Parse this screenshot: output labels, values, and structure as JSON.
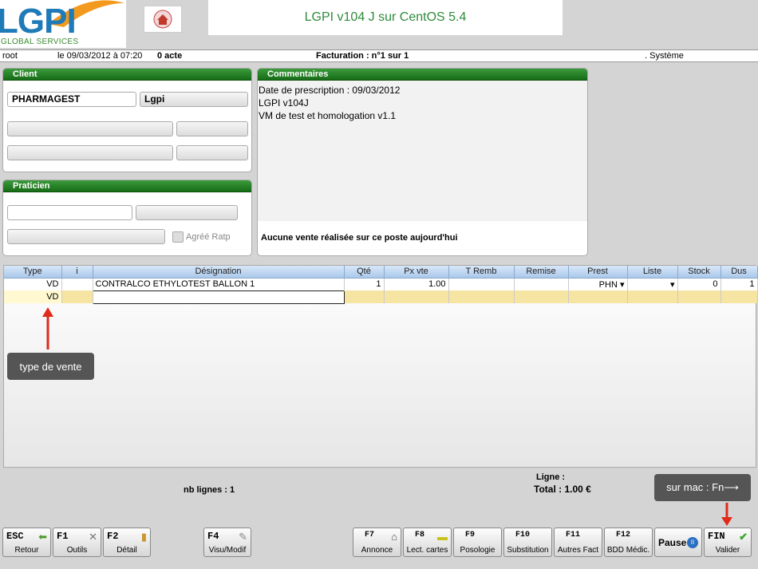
{
  "header": {
    "logo_text": "LGPI",
    "logo_sub": "GLOBAL SERVICES",
    "title": "LGPI v104 J sur CentOS 5.4"
  },
  "infobar": {
    "user": "root",
    "datetime": "le 09/03/2012 à 07:20",
    "acts": "0 acte",
    "billing": "Facturation : n°1 sur 1",
    "system": ". Système"
  },
  "client": {
    "title": "Client",
    "name": "PHARMAGEST",
    "first_name": "Lgpi"
  },
  "praticien": {
    "title": "Praticien",
    "agree_label": "Agréé Ratp"
  },
  "comments": {
    "title": "Commentaires",
    "lines": [
      "Date de prescription : 09/03/2012",
      "LGPI v104J",
      "VM de test et homologation v1.1"
    ],
    "no_sale": "Aucune vente réalisée sur ce poste aujourd'hui"
  },
  "grid": {
    "columns": [
      "Type",
      "i",
      "Désignation",
      "Qté",
      "Px vte",
      "T Remb",
      "Remise",
      "Prest",
      "Liste",
      "Stock",
      "Dus"
    ],
    "row1": {
      "type": "VD",
      "designation": "CONTRALCO ETHYLOTEST BALLON  1",
      "qte": "1",
      "px_vte": "1.00",
      "prest": "PHN",
      "stock": "0",
      "dus": "1"
    },
    "row2": {
      "type": "VD"
    }
  },
  "tips": {
    "type_vente": "type de vente",
    "mac": "sur mac : Fn⟶"
  },
  "footer": {
    "nb_lines": "nb lignes : 1",
    "ligne": "Ligne :",
    "total": "Total : 1.00 €"
  },
  "keys": {
    "esc": {
      "key": "ESC",
      "label": "Retour"
    },
    "f1": {
      "key": "F1",
      "label": "Outils"
    },
    "f2": {
      "key": "F2",
      "label": "Détail"
    },
    "f4": {
      "key": "F4",
      "label": "Visu/Modif"
    },
    "f7": {
      "key": "F7",
      "label": "Annonce"
    },
    "f8": {
      "key": "F8",
      "label": "Lect. cartes"
    },
    "f9": {
      "key": "F9",
      "label": "Posologie"
    },
    "f10": {
      "key": "F10",
      "label": "Substitution"
    },
    "f11": {
      "key": "F11",
      "label": "Autres Fact"
    },
    "f12": {
      "key": "F12",
      "label": "BDD Médic."
    },
    "pause": {
      "label": "Pause"
    },
    "fin": {
      "key": "FIN",
      "label": "Valider"
    }
  },
  "colors": {
    "green_header": "#166d16",
    "title_green": "#2e8b3a",
    "highlight_row": "#f5e4a2",
    "arrow_red": "#e02a1a"
  }
}
